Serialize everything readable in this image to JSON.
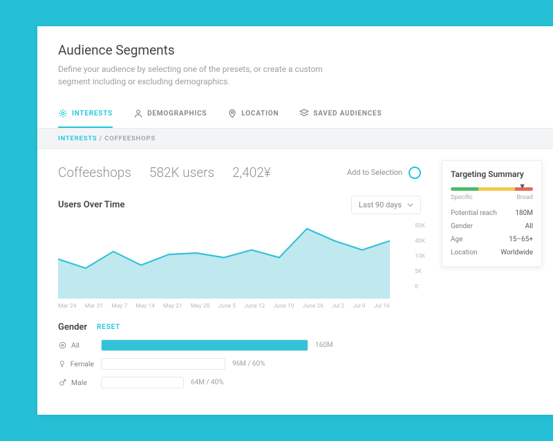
{
  "header": {
    "title": "Audience Segments",
    "subtitle": "Define your audience by selecting one of the presets, or create a custom segment including or excluding demographics."
  },
  "tabs": [
    {
      "label": "INTERESTS",
      "active": true
    },
    {
      "label": "DEMOGRAPHICS",
      "active": false
    },
    {
      "label": "LOCATION",
      "active": false
    },
    {
      "label": "SAVED AUDIENCES",
      "active": false
    }
  ],
  "breadcrumb": {
    "root": "INTERESTS",
    "leaf": "COFFEESHOPS"
  },
  "stats": {
    "name": "Coffeeshops",
    "users": "582K users",
    "cost": "2,402¥"
  },
  "add_to_selection": "Add to Selection",
  "chart": {
    "title": "Users Over Time",
    "range": "Last 90 days"
  },
  "chart_data": {
    "type": "area",
    "title": "Users Over Time",
    "xlabel": "",
    "ylabel": "",
    "ylim": [
      0,
      50000
    ],
    "yticks": [
      "50K",
      "40K",
      "10K",
      "5K",
      "0"
    ],
    "x": [
      "Mar 24",
      "Mar 31",
      "May 7",
      "May 14",
      "May 21",
      "May 28",
      "June 5",
      "June 12",
      "June 19",
      "June 26",
      "Jul 2",
      "Jul 9",
      "Jul 16"
    ],
    "values": [
      26000,
      20000,
      31000,
      22000,
      29000,
      30000,
      27000,
      32000,
      27000,
      46000,
      38000,
      32000,
      38000
    ]
  },
  "gender": {
    "title": "Gender",
    "reset": "RESET",
    "rows": [
      {
        "key": "all",
        "label": "All",
        "value": "160M",
        "fill": 1.0
      },
      {
        "key": "female",
        "label": "Female",
        "value": "96M / 60%",
        "fill": 0.6
      },
      {
        "key": "male",
        "label": "Male",
        "value": "64M / 40%",
        "fill": 0.4
      }
    ]
  },
  "summary": {
    "title": "Targeting Summary",
    "specific": "Specific",
    "broad": "Broad",
    "rows": [
      {
        "k": "Potential reach",
        "v": "180M"
      },
      {
        "k": "Gender",
        "v": "All"
      },
      {
        "k": "Age",
        "v": "15–65+"
      },
      {
        "k": "Location",
        "v": "Worldwide"
      }
    ]
  }
}
